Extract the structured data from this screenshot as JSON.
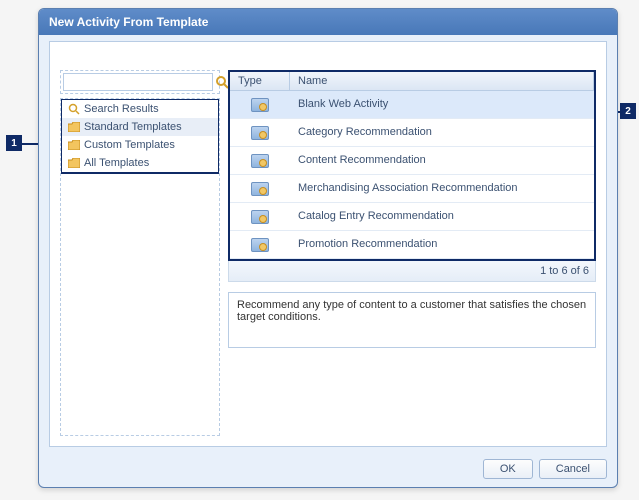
{
  "dialog": {
    "title": "New Activity From Template"
  },
  "search": {
    "value": "",
    "placeholder": ""
  },
  "tree": {
    "items": [
      {
        "label": "Search Results",
        "kind": "search"
      },
      {
        "label": "Standard Templates",
        "kind": "folder",
        "selected": true
      },
      {
        "label": "Custom Templates",
        "kind": "folder"
      },
      {
        "label": "All Templates",
        "kind": "folder"
      }
    ]
  },
  "table": {
    "headers": {
      "type": "Type",
      "name": "Name"
    },
    "rows": [
      {
        "name": "Blank Web Activity",
        "selected": true
      },
      {
        "name": "Category Recommendation"
      },
      {
        "name": "Content Recommendation"
      },
      {
        "name": "Merchandising Association Recommendation"
      },
      {
        "name": "Catalog Entry Recommendation"
      },
      {
        "name": "Promotion Recommendation"
      }
    ],
    "pager": "1 to 6 of 6"
  },
  "description": "Recommend any type of content to a customer that satisfies the chosen target conditions.",
  "buttons": {
    "ok": "OK",
    "cancel": "Cancel"
  },
  "callouts": {
    "left": "1",
    "right": "2"
  }
}
